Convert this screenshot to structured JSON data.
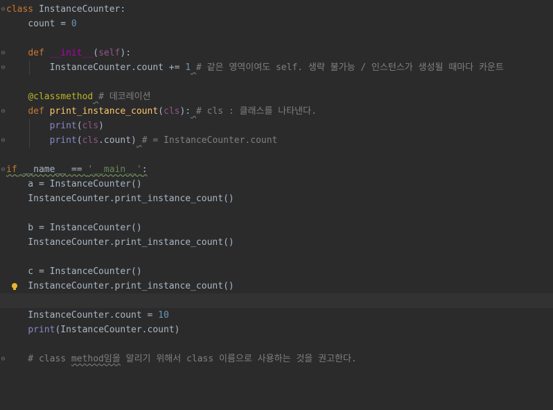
{
  "editor": {
    "l1": {
      "kw": "class",
      "name": " InstanceCounter:"
    },
    "l2": {
      "a": "    count = ",
      "num": "0"
    },
    "l4": {
      "indent": "    ",
      "kw": "def",
      "sp": " ",
      "dunder": "__init__",
      "open": "(",
      "self": "self",
      "close": "):"
    },
    "l5": {
      "a": "        InstanceCounter.count += ",
      "num": "1",
      "sp": " ",
      "cmt": "# 같은 영역이여도 self. 생략 불가능 / 인스턴스가 생성될 때마다 카운트"
    },
    "l7": {
      "indent": "    ",
      "deco": "@classmethod",
      "sp": " ",
      "cmt": "# 데코레이션"
    },
    "l8": {
      "indent": "    ",
      "kw": "def",
      "sp": " ",
      "fn": "print_instance_count",
      "open": "(",
      "self": "cls",
      "close": "):",
      "sp2": " ",
      "cmt": "# cls : 클래스를 나타낸다."
    },
    "l9": {
      "indent": "        ",
      "builtin": "print",
      "open": "(",
      "self": "cls",
      "close": ")"
    },
    "l10": {
      "indent": "        ",
      "builtin": "print",
      "open": "(",
      "self": "cls",
      "rest": ".count)",
      "sp": " ",
      "cmt": "# = InstanceCounter.count"
    },
    "l12": {
      "kw": "if",
      "sp": " ",
      "name": "__name__",
      "eq": " == ",
      "str": "'__main__'",
      "colon": ":"
    },
    "l13": {
      "a": "    a = InstanceCounter()"
    },
    "l14": {
      "a": "    InstanceCounter.print_instance_count()"
    },
    "l16": {
      "a": "    b = InstanceCounter()"
    },
    "l17": {
      "a": "    InstanceCounter.print_instance_count()"
    },
    "l19": {
      "a": "    c = InstanceCounter()"
    },
    "l20": {
      "a": "    InstanceCounter.print_instance_count()"
    },
    "l22": {
      "a": "    InstanceCounter.count = ",
      "num": "10"
    },
    "l23": {
      "indent": "    ",
      "builtin": "print",
      "rest": "(InstanceCounter.count)"
    },
    "l25": {
      "a": "    # class ",
      "w1": "method임을",
      "b": " 알리기 위해서 class 이름으로 사용하는 것을 권고한다."
    }
  },
  "icons": {
    "fold": "fold-marker-icon",
    "bulb": "lightbulb-icon"
  },
  "colors": {
    "background": "#2b2b2b",
    "keyword": "#cc7832",
    "number": "#6897bb",
    "comment": "#808080",
    "function": "#ffc66d"
  }
}
